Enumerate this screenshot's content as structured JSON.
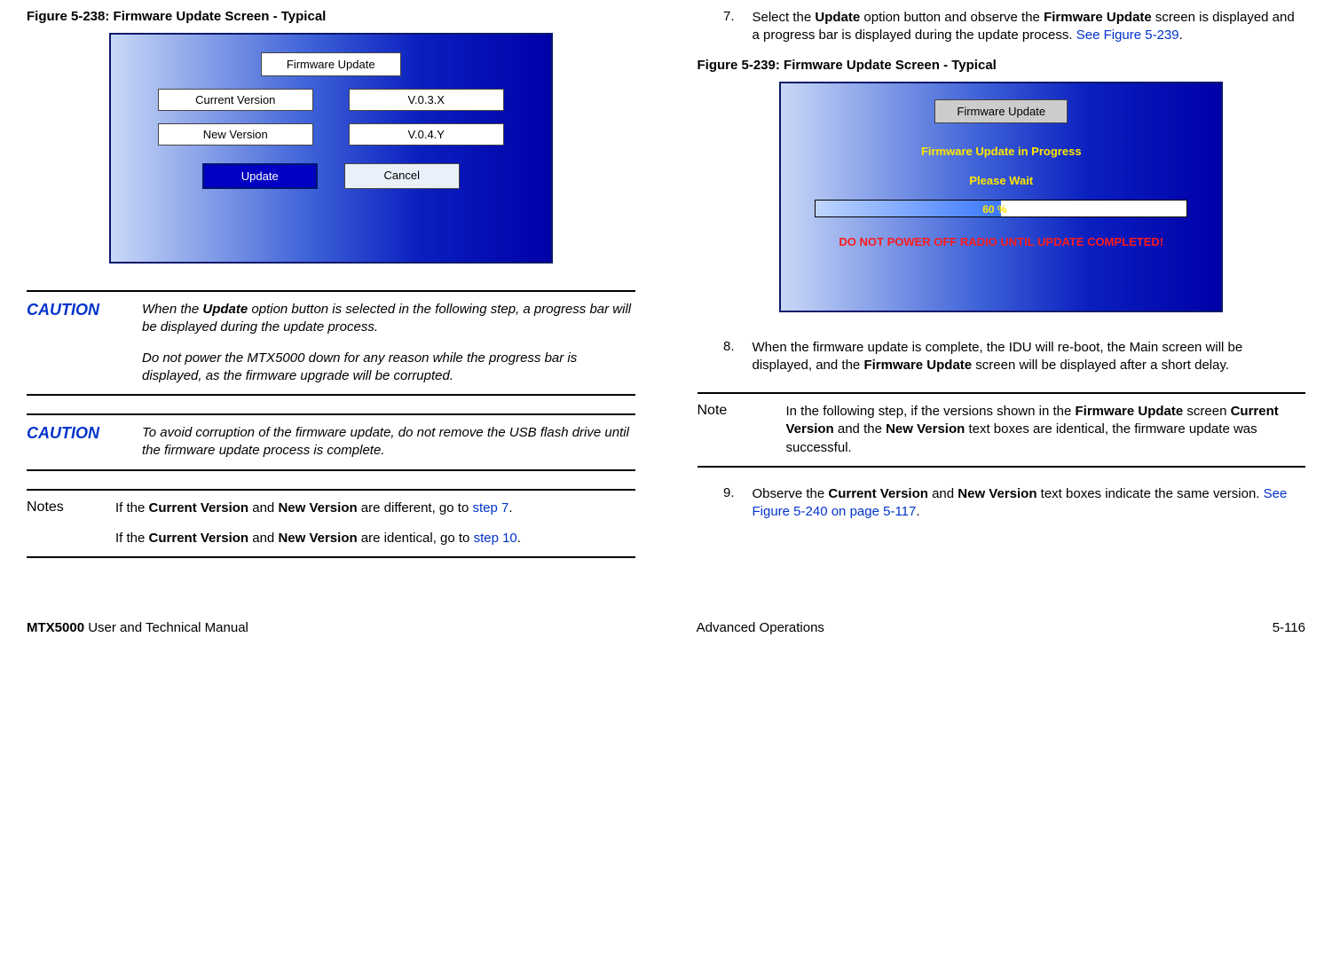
{
  "fig238": {
    "caption": "Figure 5-238:   Firmware Update Screen - Typical",
    "title": "Firmware Update",
    "current_label": "Current Version",
    "current_val": "V.0.3.X",
    "new_label": "New Version",
    "new_val": "V.0.4.Y",
    "update": "Update",
    "cancel": "Cancel"
  },
  "caution1": {
    "label": "CAUTION",
    "p1a": "When the ",
    "p1b": "Update",
    "p1c": " option button is selected in the following step, a progress bar will be displayed during the update process.",
    "p2": "Do not power the MTX5000 down for any reason while the progress bar is displayed, as the firmware upgrade will be corrupted."
  },
  "caution2": {
    "label": "CAUTION",
    "body": "To avoid corruption of the firmware update, do not remove the USB flash drive until the firmware update process is complete."
  },
  "notes_left": {
    "label": "Notes",
    "p1a": "If the ",
    "p1b": "Current Version",
    "p1c": " and ",
    "p1d": "New Version",
    "p1e": " are different, go to ",
    "link1": "step 7",
    "p1f": ".",
    "p2a": "If the ",
    "p2b": "Current Version",
    "p2c": " and ",
    "p2d": "New Version",
    "p2e": " are identical, go to ",
    "link2": "step 10",
    "p2f": "."
  },
  "step7": {
    "num": "7.",
    "a": "Select the ",
    "b": "Update",
    "c": " option button and observe the ",
    "d": "Firmware Update",
    "e": " screen is displayed and a progress bar is displayed during the update process.  ",
    "link": "See Figure 5-239",
    "f": "."
  },
  "fig239": {
    "caption": "Figure 5-239:   Firmware Update Screen - Typical",
    "title": "Firmware Update",
    "line1": "Firmware Update in Progress",
    "line2": "Please Wait",
    "pct": "60 %",
    "warn": "DO NOT POWER OFF RADIO UNTIL UPDATE COMPLETED!"
  },
  "step8": {
    "num": "8.",
    "a": "When the firmware update is complete, the IDU will re-boot, the Main screen will be displayed, and the ",
    "b": "Firmware Update",
    "c": " screen will be displayed after a short delay."
  },
  "note_right": {
    "label": "Note",
    "a": "In the following step, if the versions shown in the ",
    "b": "Firmware Update",
    "c": " screen ",
    "d": "Current Version",
    "e": " and the ",
    "f": "New Version",
    "g": " text boxes are identical, the firmware update was successful."
  },
  "step9": {
    "num": "9.",
    "a": "Observe the ",
    "b": "Current Version",
    "c": " and ",
    "d": "New Version",
    "e": " text boxes indicate the same version.  ",
    "link": "See Figure 5-240 on page 5-117",
    "f": "."
  },
  "footer": {
    "left_bold": "MTX5000",
    "left_rest": " User and Technical Manual",
    "center": "Advanced Operations",
    "right": "5-116"
  }
}
